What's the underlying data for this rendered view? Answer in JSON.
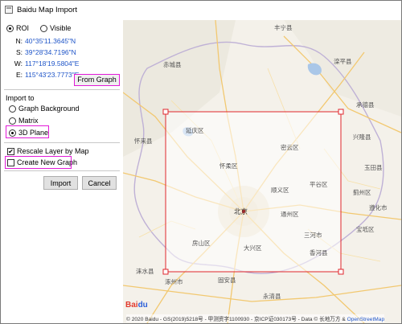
{
  "window": {
    "title": "Baidu Map Import"
  },
  "area_mode": {
    "roi_label": "ROI",
    "visible_label": "Visible",
    "selected": "ROI"
  },
  "coords": [
    {
      "key": "N:",
      "value": "40°35'11.3645\"N"
    },
    {
      "key": "S:",
      "value": "39°28'34.7196\"N"
    },
    {
      "key": "W:",
      "value": "117°18'19.5804\"E"
    },
    {
      "key": "E:",
      "value": "115°43'23.7773\"E"
    }
  ],
  "from_graph_label": "From Graph",
  "import_to": {
    "heading": "Import to",
    "options": [
      "Graph Background",
      "Matrix",
      "3D Plane"
    ],
    "selected": "3D Plane"
  },
  "rescale_layer": {
    "label": "Rescale Layer by Map",
    "checked": true,
    "mark": "✔"
  },
  "create_new_graph": {
    "label": "Create New Graph",
    "checked": false
  },
  "buttons": {
    "import": "Import",
    "cancel": "Cancel"
  },
  "map": {
    "attribution_text": "© 2020 Baidu - GS(2019)5218号 - 甲测资字1100930 - 京ICP证030173号 - Data © 长地万方 & ",
    "attribution_link": "OpenStreetMap",
    "logo_text": "Bai",
    "logo_paw": "du",
    "labels": {
      "center": "北京",
      "pinggu": "平谷区",
      "huailai": "怀来县",
      "chicheng": "赤城县",
      "luanping": "滦平县",
      "fengning": "丰宁县",
      "xinglong": "兴隆县",
      "jizhou": "蓟州区",
      "sanhe": "三河市",
      "tongzhou": "通州区",
      "gu_an": "固安县",
      "yongqing": "永清县",
      "zhuozhou": "涿州市",
      "laishui": "涞水县",
      "yanqing": "延庆区",
      "huairou": "怀柔区",
      "miyun": "密云区",
      "shunyi": "顺义区",
      "xianghe": "香河县",
      "chengde": "承德县",
      "baodi": "宝坻区",
      "tangshan": "玉田县",
      "zunhua": "遵化市",
      "fangshan": "房山区",
      "daxing": "大兴区"
    }
  },
  "colors": {
    "highlight": "#e21bd8",
    "roi": "#e0262c",
    "coord_text": "#1f55c8"
  }
}
